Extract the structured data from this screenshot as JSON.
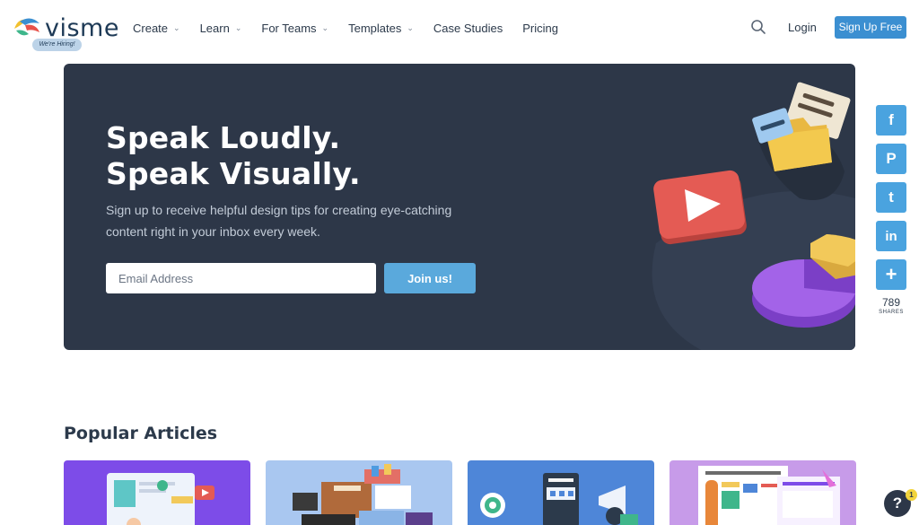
{
  "nav": {
    "logo_text": "visme",
    "hiring_badge": "We're Hiring!",
    "items": [
      {
        "label": "Create",
        "has_dropdown": true
      },
      {
        "label": "Learn",
        "has_dropdown": true
      },
      {
        "label": "For Teams",
        "has_dropdown": true
      },
      {
        "label": "Templates",
        "has_dropdown": true
      },
      {
        "label": "Case Studies",
        "has_dropdown": false
      },
      {
        "label": "Pricing",
        "has_dropdown": false
      }
    ],
    "login_label": "Login",
    "signup_label": "Sign Up Free",
    "search_icon": "search-icon"
  },
  "hero": {
    "title_line1": "Speak Loudly.",
    "title_line2": "Speak Visually.",
    "subtitle": "Sign up to receive helpful design tips for creating eye-catching content right in your inbox every week.",
    "email_placeholder": "Email Address",
    "join_label": "Join us!"
  },
  "social": {
    "buttons": [
      {
        "icon": "facebook-icon",
        "glyph": "f"
      },
      {
        "icon": "pinterest-icon",
        "glyph": "P"
      },
      {
        "icon": "twitter-icon",
        "glyph": "t"
      },
      {
        "icon": "linkedin-icon",
        "glyph": "in"
      },
      {
        "icon": "plus-icon",
        "glyph": "+"
      }
    ],
    "share_count": "789",
    "share_label": "SHARES"
  },
  "popular": {
    "title": "Popular Articles"
  },
  "help": {
    "glyph": "?",
    "badge": "1"
  },
  "colors": {
    "hero_bg": "#2d3748",
    "accent": "#3b8fd1",
    "join": "#5aa9dc",
    "social": "#4aa3df"
  }
}
